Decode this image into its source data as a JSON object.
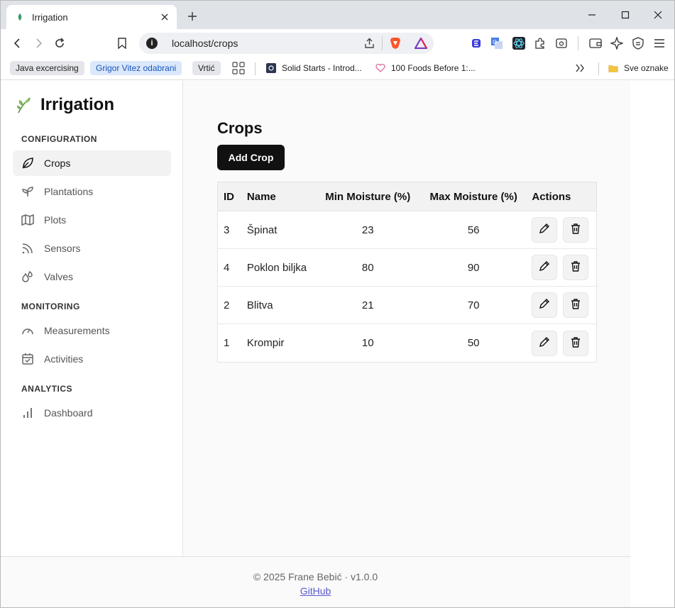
{
  "browser": {
    "tab_title": "Irrigation",
    "url": "localhost/crops",
    "bookmarks": [
      "Java excercising",
      "Grigor Vitez odabrani",
      "Vrtić",
      "Solid Starts - Introd...",
      "100 Foods Before 1:...",
      "Sve oznake"
    ]
  },
  "sidebar": {
    "brand": "Irrigation",
    "sections": {
      "configuration": "CONFIGURATION",
      "monitoring": "MONITORING",
      "analytics": "ANALYTICS"
    },
    "items": {
      "crops": "Crops",
      "plantations": "Plantations",
      "plots": "Plots",
      "sensors": "Sensors",
      "valves": "Valves",
      "measurements": "Measurements",
      "activities": "Activities",
      "dashboard": "Dashboard"
    },
    "active": "crops"
  },
  "main": {
    "title": "Crops",
    "add_button": "Add Crop",
    "columns": [
      "ID",
      "Name",
      "Min Moisture (%)",
      "Max Moisture (%)",
      "Actions"
    ],
    "rows": [
      {
        "id": "3",
        "name": "Špinat",
        "min": "23",
        "max": "56"
      },
      {
        "id": "4",
        "name": "Poklon biljka",
        "min": "80",
        "max": "90"
      },
      {
        "id": "2",
        "name": "Blitva",
        "min": "21",
        "max": "70"
      },
      {
        "id": "1",
        "name": "Krompir",
        "min": "10",
        "max": "50"
      }
    ]
  },
  "footer": {
    "text": "© 2025 Frane Bebić · v1.0.0",
    "link": "GitHub"
  },
  "colors": {
    "primary_button": "#111111",
    "active_nav_bg": "#f2f2f2",
    "link": "#5a5ad0"
  }
}
